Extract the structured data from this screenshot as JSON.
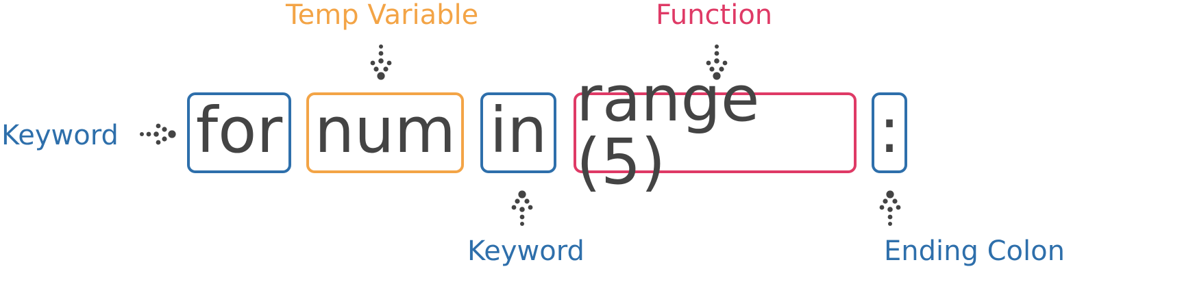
{
  "tokens": {
    "for": "for",
    "num": "num",
    "in": "in",
    "range": "range (5)",
    "colon": ":"
  },
  "labels": {
    "keyword_left": "Keyword",
    "temp_variable": "Temp Variable",
    "function": "Function",
    "keyword_bottom": "Keyword",
    "ending_colon": "Ending Colon"
  },
  "colors": {
    "keyword": "#2e6fab",
    "temp_variable": "#f3a446",
    "function": "#df3a66",
    "token_text": "#444444",
    "arrow": "#444444"
  }
}
